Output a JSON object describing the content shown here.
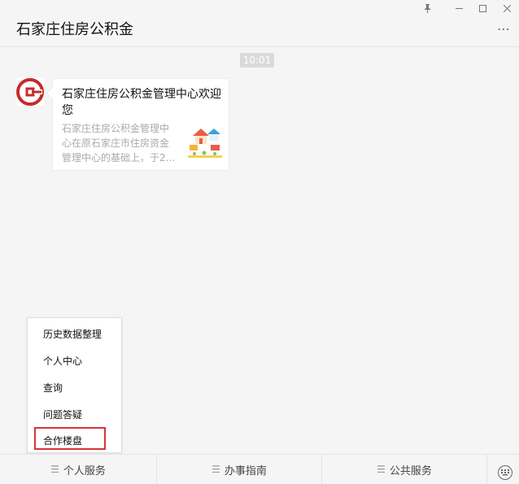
{
  "window": {
    "title": "石家庄住房公积金",
    "controls": {
      "pin": "pin-icon",
      "minimize": "minimize-icon",
      "maximize": "maximize-icon",
      "close": "close-icon"
    },
    "more": "⋯"
  },
  "chat": {
    "time": "10:01",
    "message": {
      "title": "石家庄住房公积金管理中心欢迎您",
      "description": "石家庄住房公积金管理中心在原石家庄市住房资金管理中心的基础上，于2..."
    }
  },
  "popup_menu": {
    "items": [
      "历史数据整理",
      "个人中心",
      "查询",
      "问题答疑",
      "合作楼盘"
    ],
    "highlighted_index": 4
  },
  "bottom_tabs": [
    "个人服务",
    "办事指南",
    "公共服务"
  ],
  "colors": {
    "highlight": "#d9333a",
    "logo": "#c62b2b"
  }
}
